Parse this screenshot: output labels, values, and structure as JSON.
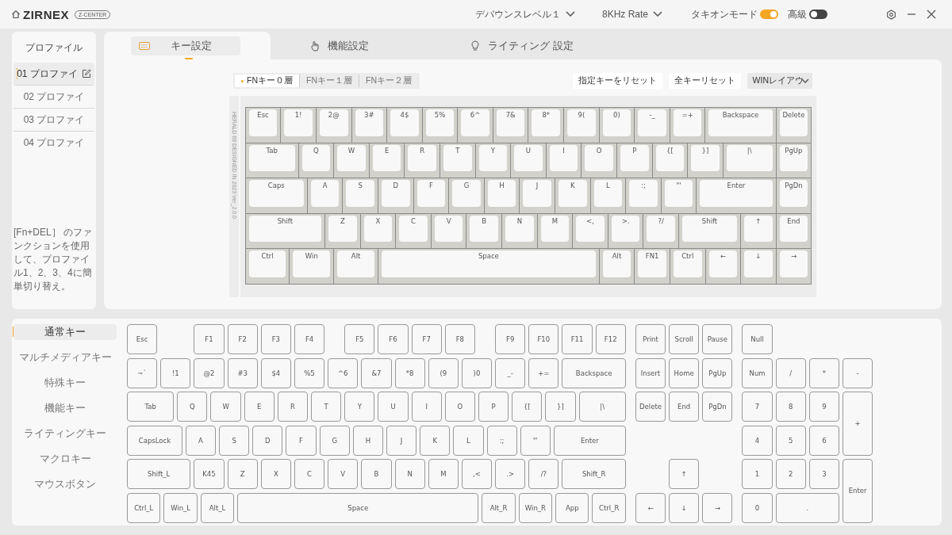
{
  "app": {
    "logo": "ZIRNEX",
    "badge": "Z-CENTER"
  },
  "top_controls": {
    "debounce": "デバウンスレベル１",
    "rate": "8KHz Rate",
    "toggles": [
      {
        "label": "タキオンモード",
        "on": true
      },
      {
        "label": "高級",
        "on": false
      }
    ]
  },
  "profiles": {
    "title": "プロファイル",
    "items": [
      {
        "label": "01 プロファイ",
        "selected": true
      },
      {
        "label": "02 プロファイ",
        "selected": false
      },
      {
        "label": "03 プロファイ",
        "selected": false
      },
      {
        "label": "04 プロファイ",
        "selected": false
      }
    ],
    "hint": "[Fn+DEL］ のファンクションを使用して、プロファイル1、2、3、4に簡単切り替え。"
  },
  "tabs": [
    {
      "label": "キー設定",
      "selected": true,
      "kind": "keys"
    },
    {
      "label": "機能設定",
      "selected": false,
      "kind": "function"
    },
    {
      "label": "ライティング 設定",
      "selected": false,
      "kind": "lighting"
    }
  ],
  "fn_layers": [
    {
      "label": "FNキー０層",
      "selected": true
    },
    {
      "label": "FNキー１層",
      "selected": false
    },
    {
      "label": "FNキー２層",
      "selected": false
    }
  ],
  "actions": [
    "指定キーをリセット",
    "全キーリセット"
  ],
  "layout_select": "WINレイアウ",
  "keyboard": {
    "side_text": "HERALD 68 DESIGNED IN 2023 Ver_2.0.0",
    "rows": [
      {
        "keys": [
          "Esc",
          "1!",
          "2@",
          "3#",
          "4$",
          "5%",
          "6^",
          "7&",
          "8*",
          "9(",
          "0)",
          "-_",
          "=+",
          "Backspace",
          "Delete"
        ]
      },
      {
        "keys": [
          "Tab",
          "Q",
          "W",
          "E",
          "R",
          "T",
          "Y",
          "U",
          "I",
          "O",
          "P",
          "{[",
          "}]",
          "|\\",
          "PgUp"
        ]
      },
      {
        "keys": [
          "Caps",
          "A",
          "S",
          "D",
          "F",
          "G",
          "H",
          "J",
          "K",
          "L",
          ":;",
          "\"'",
          "Enter",
          "PgDn"
        ]
      },
      {
        "keys": [
          "Shift",
          "Z",
          "X",
          "C",
          "V",
          "B",
          "N",
          "M",
          "<,",
          ">.",
          "?/",
          "Shift",
          "↑",
          "End"
        ]
      },
      {
        "keys": [
          "Ctrl",
          "Win",
          "Alt",
          "Space",
          "Alt",
          "FN1",
          "Ctrl",
          "←",
          "↓",
          "→"
        ]
      }
    ]
  },
  "key_categories": [
    {
      "label": "通常キー",
      "selected": true
    },
    {
      "label": "マルチメディアキー",
      "selected": false
    },
    {
      "label": "特殊キー",
      "selected": false
    },
    {
      "label": "機能キー",
      "selected": false
    },
    {
      "label": "ライティングキー",
      "selected": false
    },
    {
      "label": "マクロキー",
      "selected": false
    },
    {
      "label": "マウスボタン",
      "selected": false
    }
  ],
  "key_picker": {
    "main_rows": [
      [
        "Esc",
        "F1",
        "F2",
        "F3",
        "F4",
        "F5",
        "F6",
        "F7",
        "F8",
        "F9",
        "F10",
        "F11",
        "F12"
      ],
      [
        "~`",
        "!1",
        "@2",
        "#3",
        "$4",
        "%5",
        "^6",
        "&7",
        "*8",
        "(9",
        ")0",
        "_-",
        "+=",
        "Backspace"
      ],
      [
        "Tab",
        "Q",
        "W",
        "E",
        "R",
        "T",
        "Y",
        "U",
        "I",
        "O",
        "P",
        "{[",
        "}]",
        "|\\"
      ],
      [
        "CapsLock",
        "A",
        "S",
        "D",
        "F",
        "G",
        "H",
        "J",
        "K",
        "L",
        ":;",
        "\"'",
        "Enter"
      ],
      [
        "Shift_L",
        "K45",
        "Z",
        "X",
        "C",
        "V",
        "B",
        "N",
        "M",
        ",<",
        ".>",
        "/?",
        "Shift_R"
      ],
      [
        "Ctrl_L",
        "Win_L",
        "Alt_L",
        "Space",
        "Alt_R",
        "Win_R",
        "App",
        "Ctrl_R"
      ]
    ],
    "nav": [
      "Print",
      "Scroll",
      "Pause",
      "Insert",
      "Home",
      "PgUp",
      "Delete",
      "End",
      "PgDn",
      "↑",
      "←",
      "↓",
      "→"
    ],
    "numpad": [
      "Null",
      "Num",
      "/",
      "*",
      "-",
      "7",
      "8",
      "9",
      "+",
      "4",
      "5",
      "6",
      "1",
      "2",
      "3",
      "Enter",
      "0",
      "."
    ]
  }
}
